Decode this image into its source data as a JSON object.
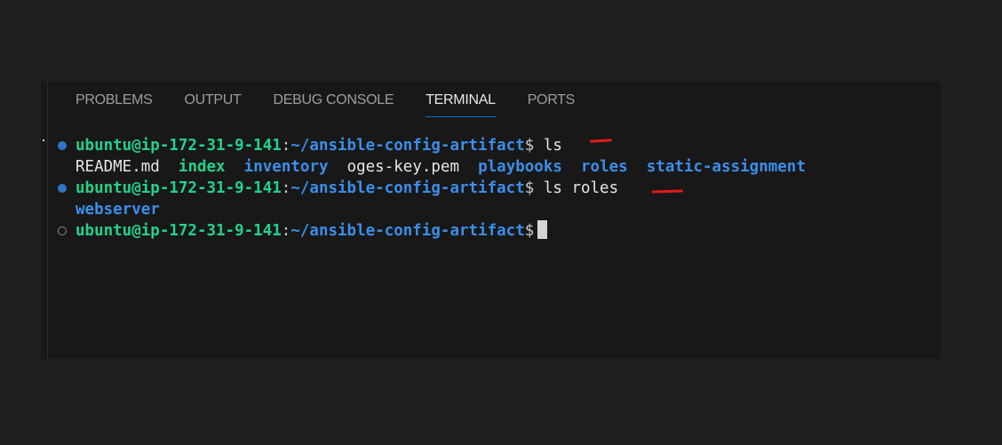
{
  "tabs": [
    {
      "label": "PROBLEMS",
      "active": false
    },
    {
      "label": "OUTPUT",
      "active": false
    },
    {
      "label": "DEBUG CONSOLE",
      "active": false
    },
    {
      "label": "TERMINAL",
      "active": true
    },
    {
      "label": "PORTS",
      "active": false
    }
  ],
  "terminal": {
    "prompt_user": "ubuntu@ip-172-31-9-141",
    "prompt_path": "~/ansible-config-artifact",
    "prompt_symbol": "$",
    "commands": [
      "ls",
      "ls roles"
    ],
    "ls_output": [
      {
        "name": "README.md",
        "kind": "file"
      },
      {
        "name": "index",
        "kind": "executable"
      },
      {
        "name": "inventory",
        "kind": "directory"
      },
      {
        "name": "oges-key.pem",
        "kind": "file"
      },
      {
        "name": "playbooks",
        "kind": "directory"
      },
      {
        "name": "roles",
        "kind": "directory"
      },
      {
        "name": "static-assignment",
        "kind": "directory"
      }
    ],
    "ls_roles_output": [
      {
        "name": "webserver",
        "kind": "directory"
      }
    ]
  },
  "colors": {
    "accent": "#0078d4",
    "user_green": "#23d18b",
    "path_blue": "#3b8eea",
    "annotation_red": "#e01b1b"
  }
}
